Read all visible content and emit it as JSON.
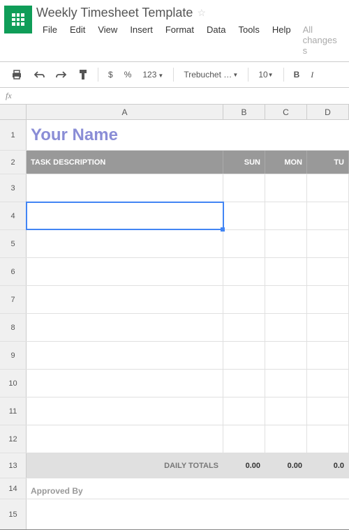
{
  "doc": {
    "title": "Weekly Timesheet Template",
    "status": "All changes s"
  },
  "menu": {
    "file": "File",
    "edit": "Edit",
    "view": "View",
    "insert": "Insert",
    "format": "Format",
    "data": "Data",
    "tools": "Tools",
    "help": "Help"
  },
  "toolbar": {
    "currency": "$",
    "percent": "%",
    "number_format": "123",
    "font": "Trebuchet …",
    "size": "10",
    "bold": "B",
    "italic": "I"
  },
  "fx": {
    "label": "fx"
  },
  "columns": {
    "A": "A",
    "B": "B",
    "C": "C",
    "D": "D"
  },
  "row_nums": [
    "1",
    "2",
    "3",
    "4",
    "5",
    "6",
    "7",
    "8",
    "9",
    "10",
    "11",
    "12",
    "13",
    "14",
    "15"
  ],
  "sheet": {
    "title_cell": "Your Name",
    "header_task": "TASK DESCRIPTION",
    "header_sun": "SUN",
    "header_mon": "MON",
    "header_tue": "TU",
    "daily_totals_label": "DAILY TOTALS",
    "total_sun": "0.00",
    "total_mon": "0.00",
    "total_tue": "0.0",
    "approved_by": "Approved By"
  }
}
